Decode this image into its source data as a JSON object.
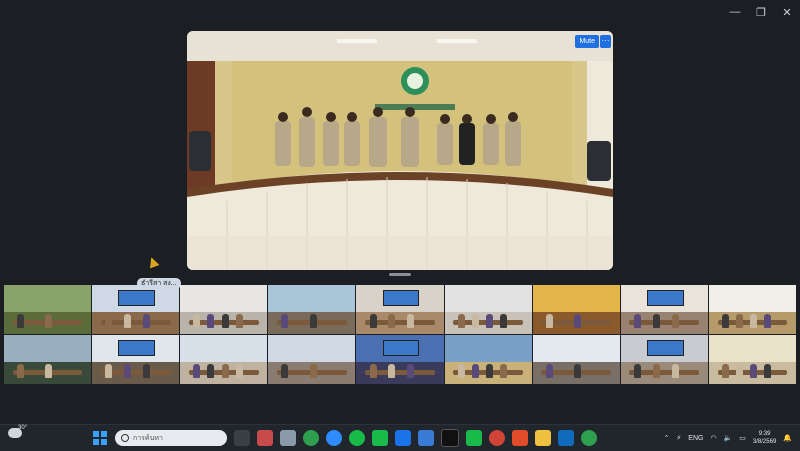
{
  "window": {
    "minimize_icon": "minimize-icon",
    "maximize_icon": "restore-icon",
    "close_icon": "close-icon",
    "min_glyph": "—",
    "max_glyph": "❐",
    "close_glyph": "✕"
  },
  "main_video": {
    "mute_label": "Mute",
    "more_label": "···"
  },
  "pinned_participant": {
    "name": "ธำรีสา สง..."
  },
  "gallery": {
    "tiles": [
      {
        "wall": "#8aa36a",
        "floor": "#5b6b3a"
      },
      {
        "wall": "#cfd9e5",
        "floor": "#8a6a4a"
      },
      {
        "wall": "#e8e6e2",
        "floor": "#b9b3aa"
      },
      {
        "wall": "#a9c6d8",
        "floor": "#7a6a5a"
      },
      {
        "wall": "#d8d2c8",
        "floor": "#a88a6a"
      },
      {
        "wall": "#e2e2e2",
        "floor": "#c9c2b8"
      },
      {
        "wall": "#e3b64a",
        "floor": "#8a5a2a"
      },
      {
        "wall": "#e9e3da",
        "floor": "#9a8270"
      },
      {
        "wall": "#f0eee8",
        "floor": "#b59a6a"
      },
      {
        "wall": "#9ab0c0",
        "floor": "#3a4a3a"
      },
      {
        "wall": "#dfe6ec",
        "floor": "#6a5a4a"
      },
      {
        "wall": "#d8e0ea",
        "floor": "#c0b2a0"
      },
      {
        "wall": "#cfd8e3",
        "floor": "#8a7c70"
      },
      {
        "wall": "#4a6fb2",
        "floor": "#3a3a5a"
      },
      {
        "wall": "#7aa0c8",
        "floor": "#c9b27a"
      },
      {
        "wall": "#e4e9ef",
        "floor": "#7a6f66"
      },
      {
        "wall": "#c8cbd0",
        "floor": "#9a8a7a"
      },
      {
        "wall": "#e9e2c9",
        "floor": "#c9bba0"
      }
    ]
  },
  "taskbar": {
    "weather_temp": "30°",
    "search_placeholder": "การค้นหา",
    "language": "ENG",
    "time": "9:39",
    "date": "3/8/2569"
  }
}
